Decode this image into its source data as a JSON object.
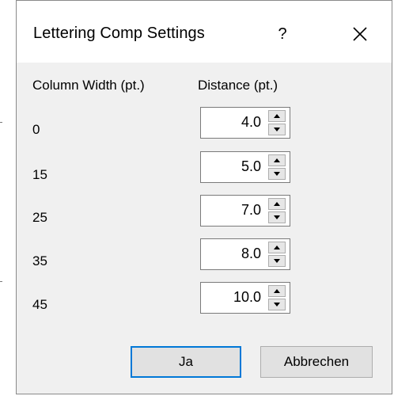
{
  "dialog": {
    "title": "Lettering Comp Settings",
    "help_label": "?",
    "close_icon": "close-icon"
  },
  "table": {
    "column_width_header": "Column Width (pt.)",
    "distance_header": "Distance (pt.)",
    "rows": [
      {
        "column_width": "0",
        "distance": "4.0"
      },
      {
        "column_width": "15",
        "distance": "5.0"
      },
      {
        "column_width": "25",
        "distance": "7.0"
      },
      {
        "column_width": "35",
        "distance": "8.0"
      },
      {
        "column_width": "45",
        "distance": "10.0"
      }
    ]
  },
  "buttons": {
    "ok_label": "Ja",
    "cancel_label": "Abbrechen"
  },
  "colors": {
    "dialog_background": "#f0f0f0",
    "title_background": "#ffffff",
    "default_button_border": "#0078d7"
  }
}
